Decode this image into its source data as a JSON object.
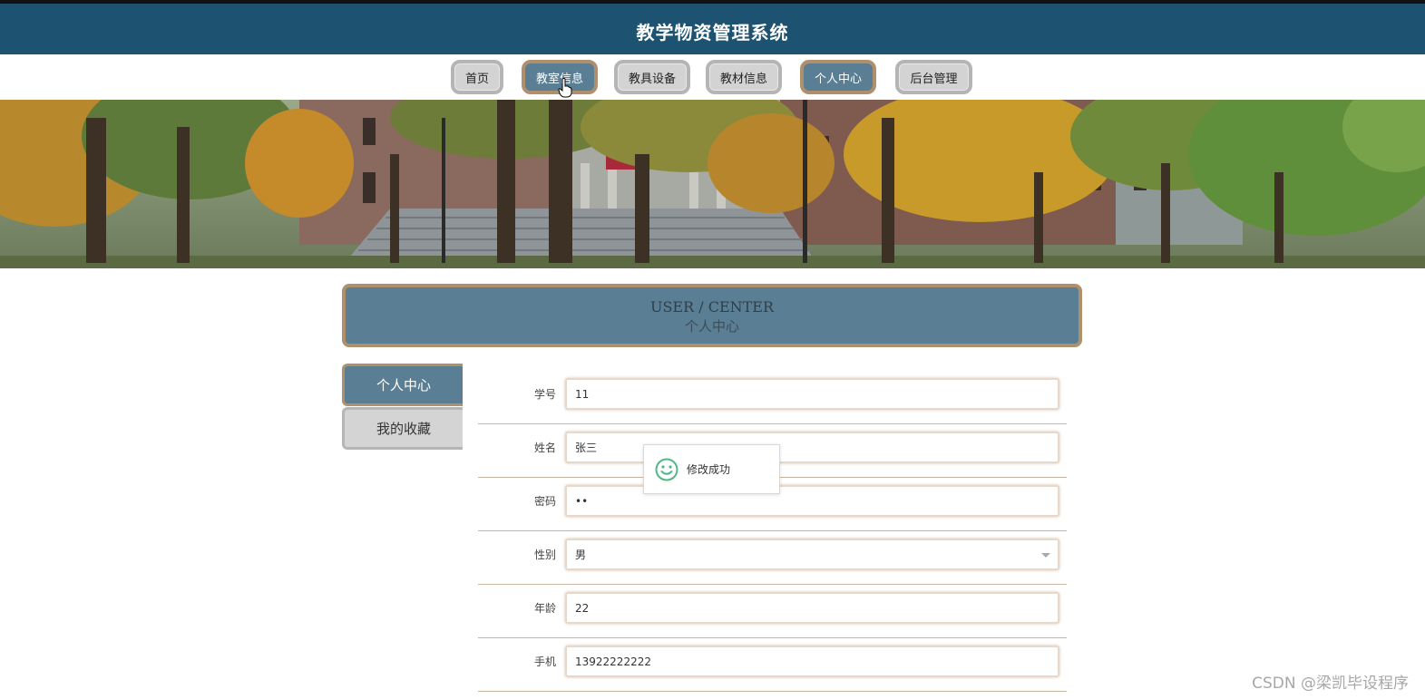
{
  "header": {
    "title": "教学物资管理系统"
  },
  "nav": {
    "items": [
      {
        "label": "首页",
        "active": false
      },
      {
        "label": "教室信息",
        "active": true
      },
      {
        "label": "教具设备",
        "active": false
      },
      {
        "label": "教材信息",
        "active": false
      },
      {
        "label": "个人中心",
        "active": true
      },
      {
        "label": "后台管理",
        "active": false
      }
    ]
  },
  "user_center": {
    "title_en": "USER / CENTER",
    "title_cn": "个人中心"
  },
  "sidebar": {
    "items": [
      {
        "label": "个人中心",
        "active": true
      },
      {
        "label": "我的收藏",
        "active": false
      }
    ]
  },
  "form": {
    "fields": [
      {
        "label": "学号",
        "value": "11"
      },
      {
        "label": "姓名",
        "value": "张三"
      },
      {
        "label": "密码",
        "value": "••"
      },
      {
        "label": "性别",
        "value": "男"
      },
      {
        "label": "年龄",
        "value": "22"
      },
      {
        "label": "手机",
        "value": "13922222222"
      }
    ]
  },
  "toast": {
    "message": "修改成功",
    "icon": "smile-icon"
  },
  "watermark": {
    "text": "CSDN @梁凯毕设程序"
  },
  "colors": {
    "header_bg": "#1d5370",
    "accent": "#5a7e93",
    "accent_border": "#b08f6c",
    "inactive_bg": "#d3d3d3"
  }
}
